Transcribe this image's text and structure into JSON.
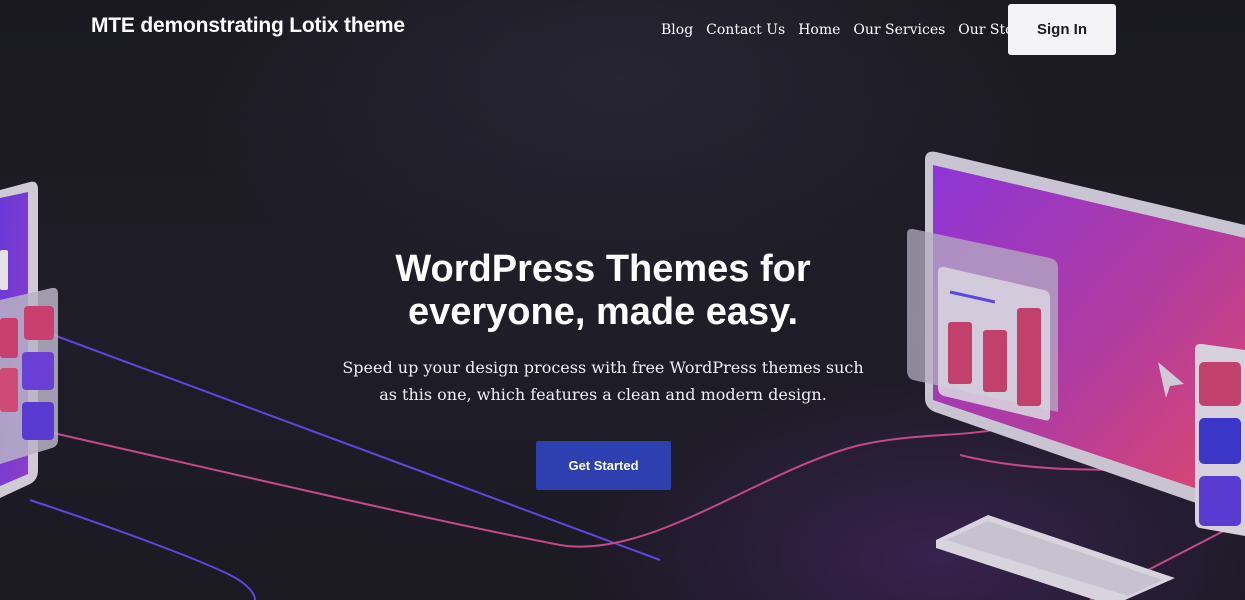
{
  "header": {
    "site_title": "MTE demonstrating Lotix theme",
    "nav": [
      "Blog",
      "Contact Us",
      "Home",
      "Our Services",
      "Our Story"
    ],
    "signin_label": "Sign In"
  },
  "hero": {
    "title_line1": "WordPress Themes for",
    "title_line2": "everyone, made easy.",
    "subtitle_line1": "Speed up your design process with free WordPress themes such",
    "subtitle_line2": "as this one, which features a clean and modern design.",
    "cta_label": "Get Started"
  },
  "colors": {
    "background": "#1c1b23",
    "cta": "#2e3fb0",
    "signin_bg": "#f3f3f6",
    "accent_purple": "#7a3fd0",
    "accent_pink": "#c8407a"
  },
  "illustration": {
    "icons": [
      "monitor-illustration",
      "bar-chart-icon",
      "cursor-icon",
      "keyboard-illustration",
      "tablet-illustration"
    ]
  }
}
